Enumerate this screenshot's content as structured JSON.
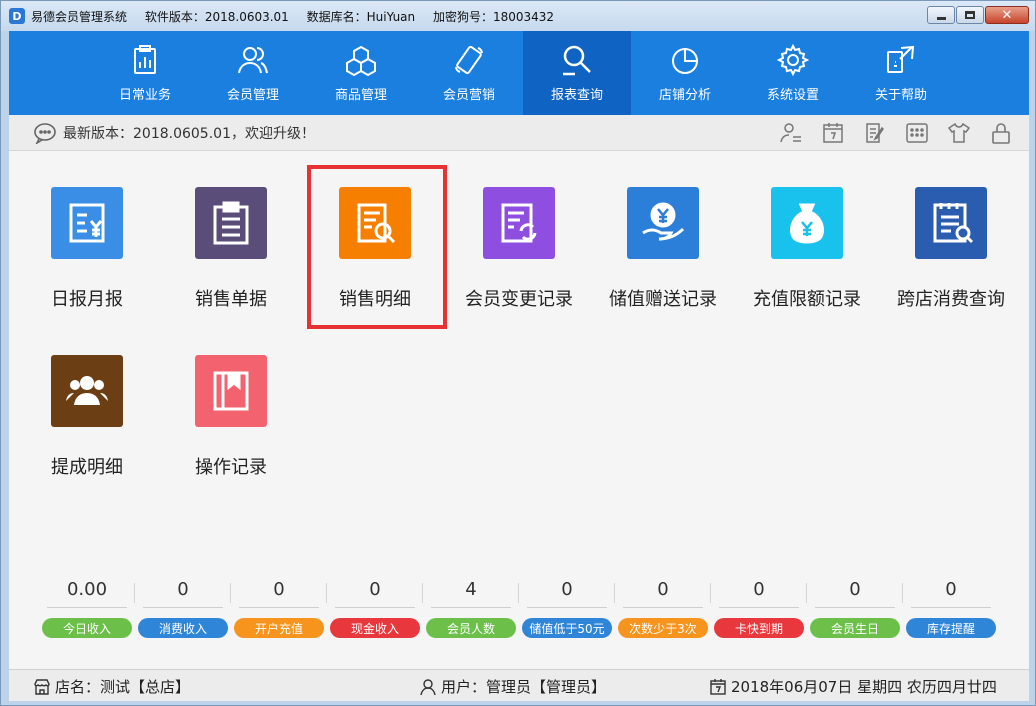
{
  "window": {
    "logo": "D",
    "app_name": "易德会员管理系统",
    "version": "软件版本：2018.0603.01",
    "database": "数据库名：HuiYuan",
    "dongle": "加密狗号：18003432"
  },
  "nav": [
    {
      "label": "日常业务",
      "icon": "clipboard-chart-icon"
    },
    {
      "label": "会员管理",
      "icon": "members-icon"
    },
    {
      "label": "商品管理",
      "icon": "cubes-icon"
    },
    {
      "label": "会员营销",
      "icon": "phone-icon"
    },
    {
      "label": "报表查询",
      "icon": "search-report-icon",
      "active": true
    },
    {
      "label": "店铺分析",
      "icon": "pie-chart-icon"
    },
    {
      "label": "系统设置",
      "icon": "gear-icon"
    },
    {
      "label": "关于帮助",
      "icon": "help-icon"
    }
  ],
  "notice": {
    "text": "最新版本：2018.0605.01，欢迎升级！"
  },
  "tiles": [
    {
      "label": "日报月报",
      "color": "#3a8ee6"
    },
    {
      "label": "销售单据",
      "color": "#5a4d79"
    },
    {
      "label": "销售明细",
      "color": "#f77f00"
    },
    {
      "label": "会员变更记录",
      "color": "#8e4fe0"
    },
    {
      "label": "储值赠送记录",
      "color": "#2b7fd9"
    },
    {
      "label": "充值限额记录",
      "color": "#19c2ec"
    },
    {
      "label": "跨店消费查询",
      "color": "#2a5db0"
    },
    {
      "label": "提成明细",
      "color": "#6b3e14"
    },
    {
      "label": "操作记录",
      "color": "#f2636f"
    }
  ],
  "stats": [
    {
      "value": "0.00",
      "label": "今日收入",
      "color": "#6cc04a"
    },
    {
      "value": "0",
      "label": "消费收入",
      "color": "#2f86d8"
    },
    {
      "value": "0",
      "label": "开户充值",
      "color": "#f7941d"
    },
    {
      "value": "0",
      "label": "现金收入",
      "color": "#e8383d"
    },
    {
      "value": "4",
      "label": "会员人数",
      "color": "#6cc04a"
    },
    {
      "value": "0",
      "label": "储值低于50元",
      "color": "#2f86d8"
    },
    {
      "value": "0",
      "label": "次数少于3次",
      "color": "#f7941d"
    },
    {
      "value": "0",
      "label": "卡快到期",
      "color": "#e8383d"
    },
    {
      "value": "0",
      "label": "会员生日",
      "color": "#6cc04a"
    },
    {
      "value": "0",
      "label": "库存提醒",
      "color": "#2f86d8"
    }
  ],
  "status": {
    "store": "店名：测试【总店】",
    "user": "用户：管理员【管理员】",
    "date": "2018年06月07日 星期四 农历四月廿四"
  }
}
